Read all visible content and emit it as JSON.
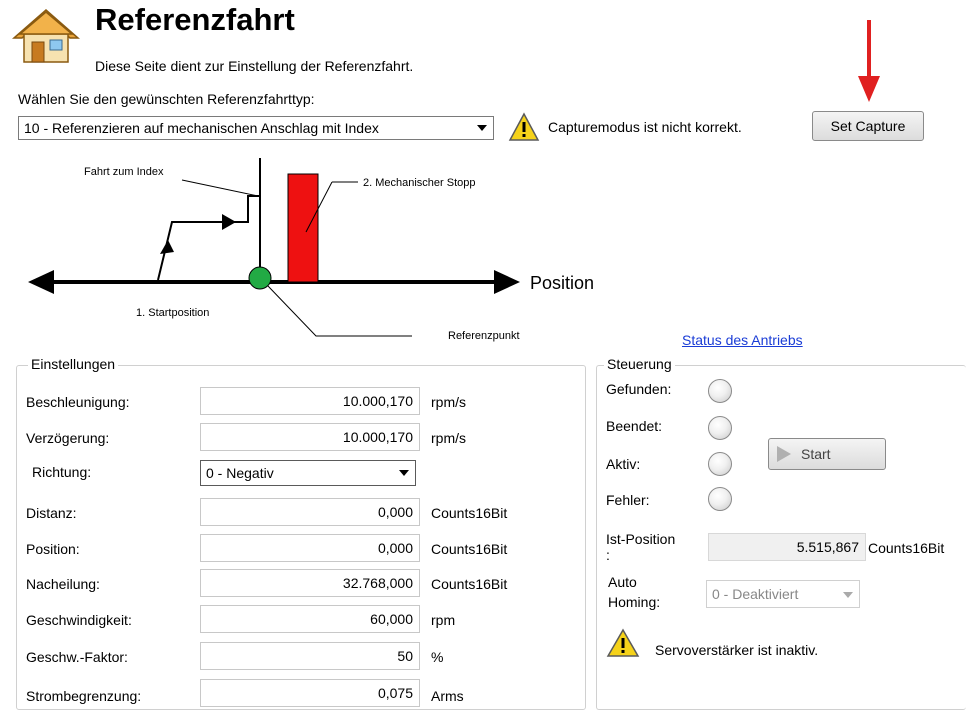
{
  "header": {
    "title": "Referenzfahrt",
    "subtitle": "Diese Seite dient zur Einstellung der Referenzfahrt.",
    "type_prompt": "Wählen Sie den gewünschten Referenzfahrttyp:",
    "type_selected": "10 - Referenzieren auf mechanischen Anschlag mit Index",
    "warning_text": "Capturemodus ist nicht korrekt.",
    "set_capture_label": "Set Capture"
  },
  "diagram": {
    "label_index": "Fahrt zum Index",
    "label_stop": "2. Mechanischer Stopp",
    "label_position": "Position",
    "label_start": "1. Startposition",
    "label_ref": "Referenzpunkt",
    "colors": {
      "stop": "#ee1111",
      "ref_point": "#22aa44"
    }
  },
  "status_link": "Status des Antriebs",
  "settings": {
    "legend": "Einstellungen",
    "rows": [
      {
        "label": "Beschleunigung:",
        "value": "10.000,170",
        "unit": "rpm/s"
      },
      {
        "label": "Verzögerung:",
        "value": "10.000,170",
        "unit": "rpm/s"
      },
      {
        "label": "Richtung:",
        "value": "0 - Negativ",
        "unit": ""
      },
      {
        "label": "Distanz:",
        "value": "0,000",
        "unit": "Counts16Bit"
      },
      {
        "label": "Position:",
        "value": "0,000",
        "unit": "Counts16Bit"
      },
      {
        "label": "Nacheilung:",
        "value": "32.768,000",
        "unit": "Counts16Bit"
      },
      {
        "label": "Geschwindigkeit:",
        "value": "60,000",
        "unit": "rpm"
      },
      {
        "label": "Geschw.-Faktor:",
        "value": "50",
        "unit": "%"
      },
      {
        "label": "Strombegrenzung:",
        "value": "0,075",
        "unit": "Arms"
      }
    ]
  },
  "control": {
    "legend": "Steuerung",
    "gefunden": "Gefunden:",
    "beendet": "Beendet:",
    "aktiv": "Aktiv:",
    "fehler": "Fehler:",
    "start_label": "Start",
    "ist_position_label_1": "Ist-Position",
    "ist_position_label_2": ":",
    "ist_position_value": "5.515,867",
    "ist_position_unit": "Counts16Bit",
    "auto_homing_label_1": "Auto",
    "auto_homing_label_2": "Homing:",
    "auto_homing_value": "0 - Deaktiviert",
    "servo_warning": "Servoverstärker ist inaktiv."
  },
  "annotation": {
    "arrow_color": "#e02020"
  }
}
